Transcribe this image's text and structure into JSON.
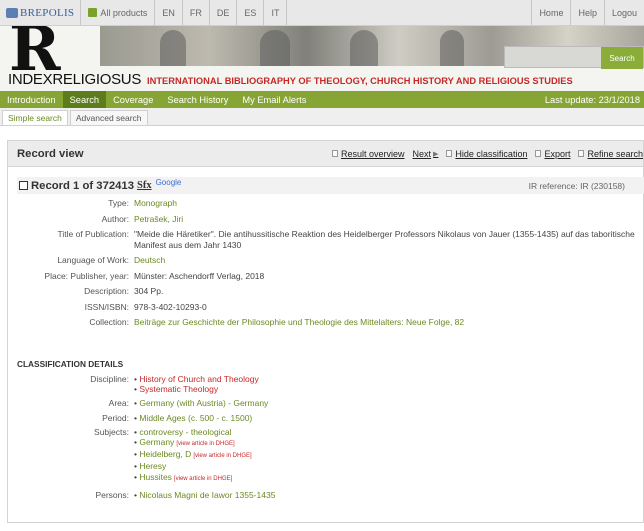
{
  "topbar": {
    "brand": "BREPOLIS",
    "all_products": "All products",
    "languages": [
      "EN",
      "FR",
      "DE",
      "ES",
      "IT"
    ],
    "right_links": [
      "Home",
      "Help",
      "Logou"
    ]
  },
  "banner": {
    "big_letter": "R",
    "index_name": "INDEXRELIGIOSUS",
    "subtitle": "INTERNATIONAL BIBLIOGRAPHY OF THEOLOGY, CHURCH HISTORY AND RELIGIOUS STUDIES",
    "search_button": "Search"
  },
  "nav": {
    "items": [
      "Introduction",
      "Search",
      "Coverage",
      "Search History",
      "My Email Alerts"
    ],
    "last_update": "Last update: 23/1/2018"
  },
  "subnav": {
    "tabs": [
      "Simple search",
      "Advanced search"
    ]
  },
  "record_view": {
    "title": "Record view",
    "actions": {
      "result_overview": "Result overview",
      "next": "Next",
      "hide_classification": "Hide classification",
      "export": "Export",
      "refine_search": "Refine search"
    },
    "record_label": "Record 1 of 372413",
    "sfx": "Sfx",
    "google": "Google",
    "ir_reference": "IR reference: IR (230158)"
  },
  "fields": {
    "type": {
      "label": "Type:",
      "value": "Monograph"
    },
    "author": {
      "label": "Author:",
      "value": "Petrašek, Jiri"
    },
    "title_pub": {
      "label": "Title of Publication:",
      "value": "\"Meide die Häretiker\". Die antihussitische Reaktion des Heidelberger Professors Nikolaus von Jauer (1355-1435) auf das taboritische Manifest aus dem Jahr 1430"
    },
    "language": {
      "label": "Language of Work:",
      "value": "Deutsch"
    },
    "place": {
      "label": "Place: Publisher, year:",
      "value": "Münster: Aschendorff Verlag, 2018"
    },
    "description": {
      "label": "Description:",
      "value": "304 Pp."
    },
    "issn": {
      "label": "ISSN/ISBN:",
      "value": "978-3-402-10293-0"
    },
    "collection": {
      "label": "Collection:",
      "value": "Beiträge zur Geschichte der Philosophie und Theologie des Mittelalters: Neue Folge, 82"
    }
  },
  "classification": {
    "heading": "CLASSIFICATION DETAILS",
    "discipline_label": "Discipline:",
    "discipline": [
      "History of Church and Theology",
      "Systematic Theology"
    ],
    "area_label": "Area:",
    "area": "Germany (with Austria) - Germany",
    "period_label": "Period:",
    "period": "Middle Ages (c. 500 - c. 1500)",
    "subjects_label": "Subjects:",
    "subjects": [
      {
        "text": "controversy - theological",
        "note": ""
      },
      {
        "text": "Germany",
        "note": "[view article in DHGE]"
      },
      {
        "text": "Heidelberg, D",
        "note": "[view article in DHGE]"
      },
      {
        "text": "Heresy",
        "note": ""
      },
      {
        "text": "Hussites",
        "note": "[view article in DHGE]"
      }
    ],
    "persons_label": "Persons:",
    "persons": "Nicolaus Magni de Iawor 1355-1435"
  }
}
